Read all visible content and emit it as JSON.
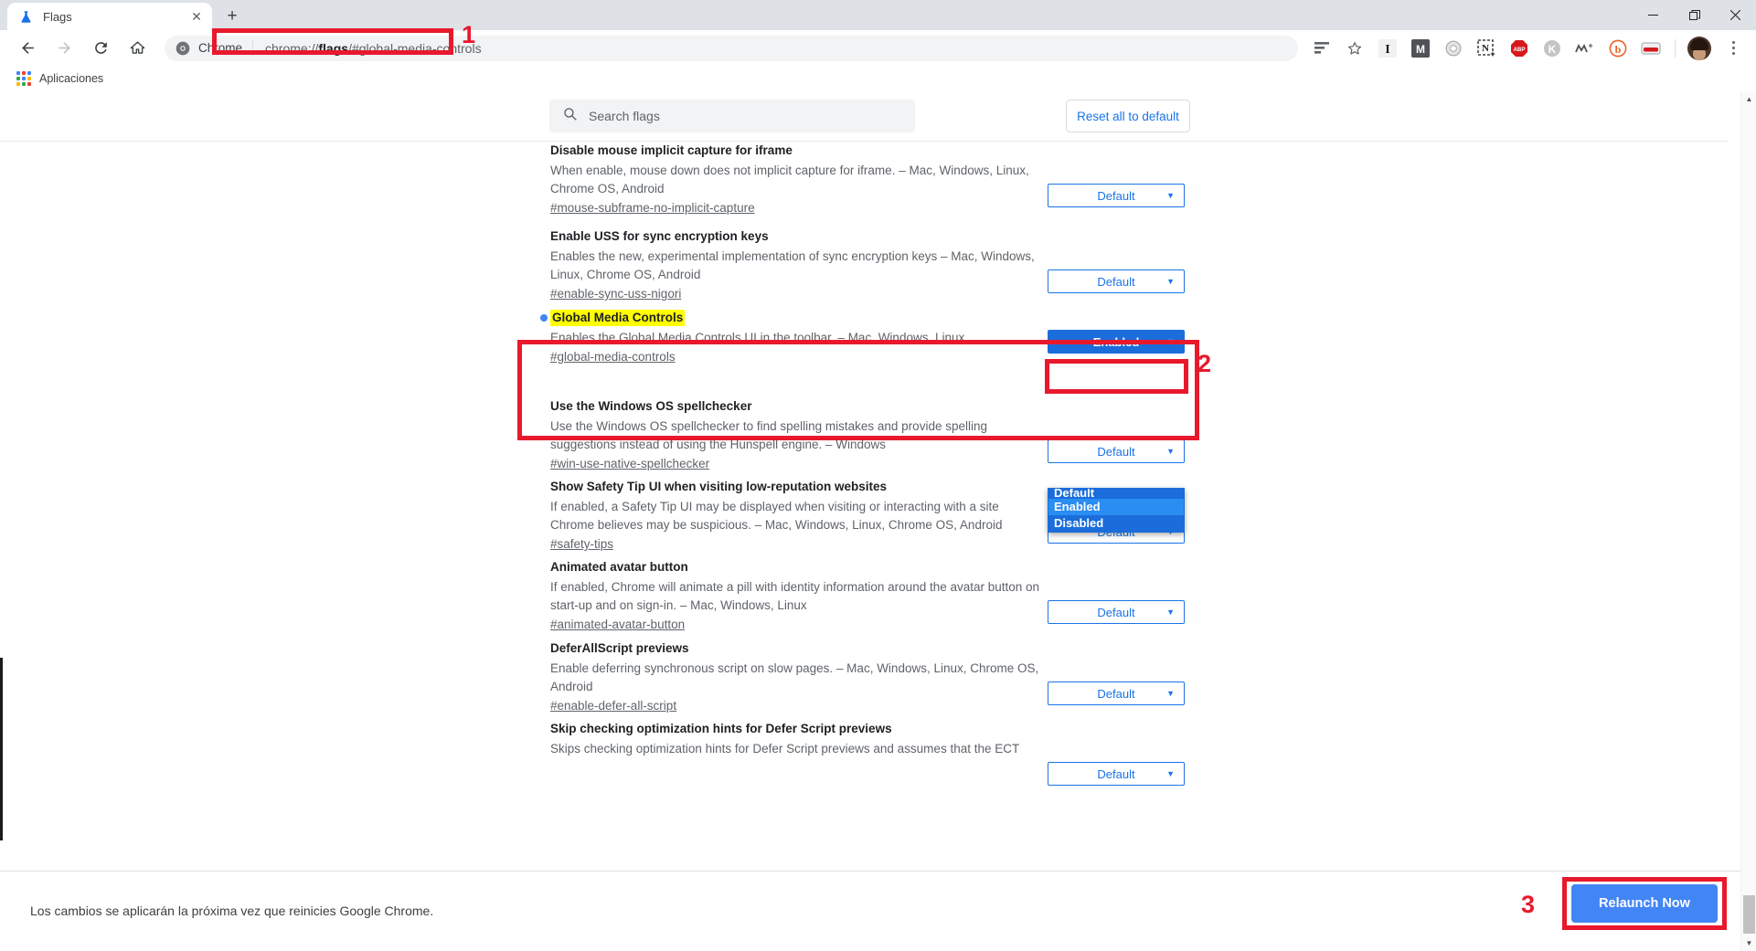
{
  "window": {
    "minimize_label": "—",
    "maximize_label": "❐",
    "close_label": "✕"
  },
  "tab": {
    "title": "Flags",
    "close_label": "✕",
    "newtab_label": "+"
  },
  "toolbar": {
    "back_label": "←",
    "forward_label": "→",
    "reload_label": "↻",
    "home_label": "⌂",
    "chip_label": "Chrome",
    "url_prefix": "chrome://",
    "url_bold": "flags",
    "url_suffix": "/#global-media-controls",
    "url_full": "chrome://flags/#global-media-controls",
    "extensions": [
      {
        "name": "reading-list-icon",
        "glyph": "☰"
      },
      {
        "name": "bookmark-star-icon",
        "glyph": "☆"
      },
      {
        "name": "instapaper-extension-icon",
        "glyph": "I"
      },
      {
        "name": "mail-extension-icon",
        "glyph": "M"
      },
      {
        "name": "gear-extension-icon",
        "glyph": "⚙"
      },
      {
        "name": "notion-extension-icon",
        "glyph": "N"
      },
      {
        "name": "adblock-plus-extension-icon",
        "glyph": "ABP"
      },
      {
        "name": "honey-extension-icon",
        "glyph": "K"
      },
      {
        "name": "movistar-extension-icon",
        "glyph": "ᴍ⁺"
      },
      {
        "name": "bitly-extension-icon",
        "glyph": "b"
      },
      {
        "name": "bandit-extension-icon",
        "glyph": "▬"
      }
    ]
  },
  "bookmarks": {
    "apps_label": "Aplicaciones"
  },
  "flags_page": {
    "search_placeholder": "Search flags",
    "reset_label": "Reset all to default",
    "select_options": [
      "Default",
      "Enabled",
      "Disabled"
    ],
    "entries": [
      {
        "name": "Disable mouse implicit capture for iframe",
        "description": "When enable, mouse down does not implicit capture for iframe. – Mac, Windows, Linux, Chrome OS, Android",
        "anchor": "#mouse-subframe-no-implicit-capture",
        "value": "Default",
        "highlighted": false
      },
      {
        "name": "Enable USS for sync encryption keys",
        "description": "Enables the new, experimental implementation of sync encryption keys – Mac, Windows, Linux, Chrome OS, Android",
        "anchor": "#enable-sync-uss-nigori",
        "value": "Default",
        "highlighted": false
      },
      {
        "name": "Global Media Controls",
        "description": "Enables the Global Media Controls UI in the toolbar. – Mac, Windows, Linux",
        "anchor": "#global-media-controls",
        "value": "Enabled",
        "highlighted": true
      },
      {
        "name": "Use the Windows OS spellchecker",
        "description": "Use the Windows OS spellchecker to find spelling mistakes and provide spelling suggestions instead of using the Hunspell engine. – Windows",
        "anchor": "#win-use-native-spellchecker",
        "value": "Default",
        "highlighted": false
      },
      {
        "name": "Show Safety Tip UI when visiting low-reputation websites",
        "description": "If enabled, a Safety Tip UI may be displayed when visiting or interacting with a site Chrome believes may be suspicious. – Mac, Windows, Linux, Chrome OS, Android",
        "anchor": "#safety-tips",
        "value": "Default",
        "highlighted": false
      },
      {
        "name": "Animated avatar button",
        "description": "If enabled, Chrome will animate a pill with identity information around the avatar button on start-up and on sign-in. – Mac, Windows, Linux",
        "anchor": "#animated-avatar-button",
        "value": "Default",
        "highlighted": false
      },
      {
        "name": "DeferAllScript previews",
        "description": "Enable deferring synchronous script on slow pages. – Mac, Windows, Linux, Chrome OS, Android",
        "anchor": "#enable-defer-all-script",
        "value": "Default",
        "highlighted": false
      },
      {
        "name": "Skip checking optimization hints for Defer Script previews",
        "description": "Skips checking optimization hints for Defer Script previews and assumes that the ECT",
        "anchor": "",
        "value": "Default",
        "highlighted": false
      }
    ]
  },
  "dropdown": {
    "options": [
      "Default",
      "Enabled",
      "Disabled"
    ],
    "selected": "Enabled"
  },
  "relaunch": {
    "message": "Los cambios se aplicarán la próxima vez que reinicies Google Chrome.",
    "button_label": "Relaunch Now"
  },
  "annotations": {
    "step1": "1",
    "step2": "2",
    "step3": "3",
    "color": "#e8192c"
  }
}
